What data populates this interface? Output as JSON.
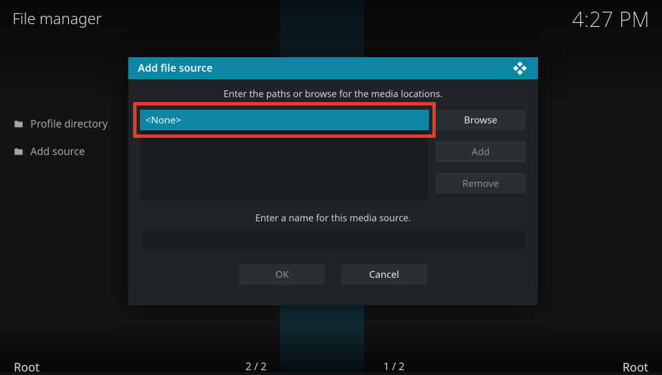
{
  "header": {
    "title": "File manager",
    "clock": "4:27 PM"
  },
  "sidebar": {
    "items": [
      {
        "label": "Profile directory"
      },
      {
        "label": "Add source"
      }
    ]
  },
  "dialog": {
    "title": "Add file source",
    "prompt_paths": "Enter the paths or browse for the media locations.",
    "path_value": "<None>",
    "browse_label": "Browse",
    "add_label": "Add",
    "remove_label": "Remove",
    "prompt_name": "Enter a name for this media source.",
    "name_value": "",
    "ok_label": "OK",
    "cancel_label": "Cancel"
  },
  "status": {
    "left_label": "Root",
    "left_pos": "2 / 2",
    "right_pos": "1 / 2",
    "right_label": "Root"
  }
}
